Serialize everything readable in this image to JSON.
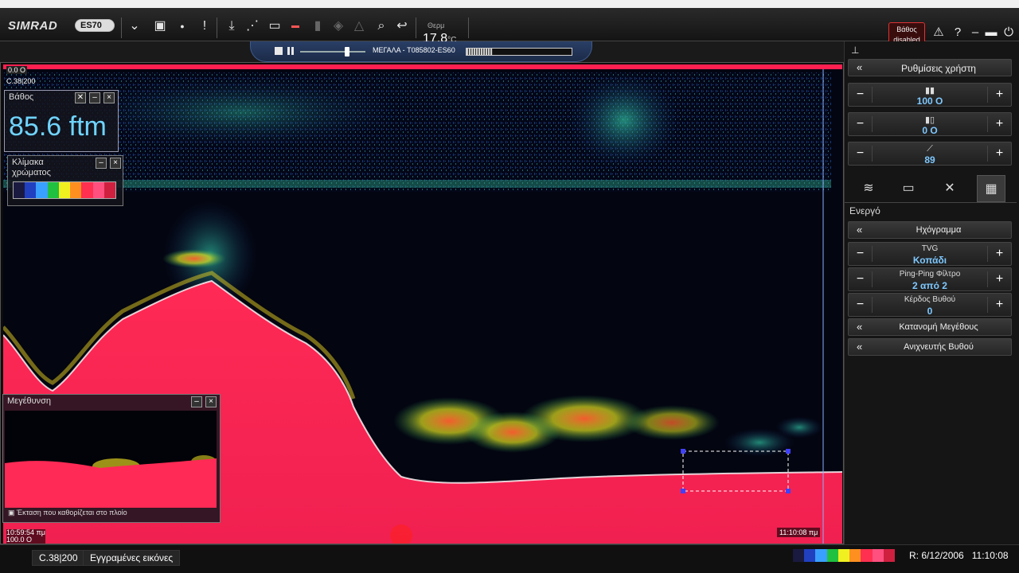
{
  "header": {
    "brand": "SIMRAD",
    "model": "ES70",
    "temp_label": "Θερμ",
    "temp_value": "17.8",
    "temp_unit": "°C",
    "alarm_label": "Βάθος",
    "alarm_status": "disabled",
    "icons": [
      "chevron-down-icon",
      "camera-icon",
      "rec-icon",
      "alert-icon",
      "download-icon",
      "chart-icon",
      "folder-icon",
      "color-scale-icon",
      "bars-icon",
      "fish-icon",
      "stack-icon",
      "zoom-icon",
      "return-icon"
    ],
    "window_buttons": [
      "warning-icon",
      "help-icon",
      "minimize-icon",
      "maximize-icon",
      "power-icon"
    ]
  },
  "playback": {
    "file_name": "ΜΕΓΑΛΑ - T085802-ES60",
    "progress_fraction": 0.25
  },
  "echogram": {
    "top_readout": "0.0 O",
    "channel": "C.38|200",
    "time_start": "10:59:54 πμ",
    "range_bottom": "100.0 O",
    "time_end": "11:10:08 πμ"
  },
  "depth_panel": {
    "title": "Βάθος",
    "value": "85.6 ftm"
  },
  "color_panel": {
    "title": "Κλίμακα χρώματος",
    "colors": [
      "#1a1a40",
      "#2040c0",
      "#3aa0ff",
      "#20c040",
      "#f0f020",
      "#ff9020",
      "#ff3050",
      "#ff5080",
      "#d02040"
    ]
  },
  "zoom_panel": {
    "title": "Μεγέθυνση",
    "caption": "Έκταση που καθορίζεται στο πλοίο"
  },
  "right_panel": {
    "user_settings": "Ρυθμίσεις χρήστη",
    "rows_top": [
      {
        "icon": "range-icon",
        "value": "100 O"
      },
      {
        "icon": "start-depth-icon",
        "value": "0 O"
      },
      {
        "icon": "gain-slope-icon",
        "value": "89"
      }
    ],
    "tabs": [
      "echo-tab-icon",
      "display-tab-icon",
      "tools-tab-icon",
      "layout-tab-icon"
    ],
    "section": "Ενεργό",
    "echogram_header": "Ηχόγραμμα",
    "rows_bottom": [
      {
        "caption": "TVG",
        "value": "Κοπάδι"
      },
      {
        "caption": "Ping-Ping Φίλτρο",
        "value": "2 από 2"
      },
      {
        "caption": "Κέρδος Βυθού",
        "value": "0"
      }
    ],
    "size_distribution": "Κατανομή Μεγέθους",
    "bottom_detector": "Ανιχνευτής Βυθού"
  },
  "status": {
    "channel": "C.38|200",
    "recorded": "Εγγραμένες εικόνες",
    "date": "R: 6/12/2006",
    "time": "11:10:08"
  }
}
